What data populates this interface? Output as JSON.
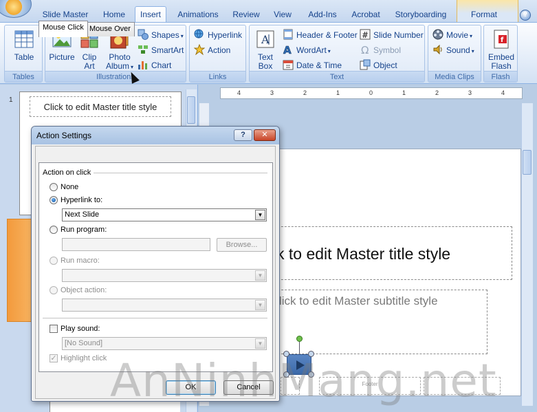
{
  "ribbon_tabs": [
    "Slide Master",
    "Home",
    "Insert",
    "Animations",
    "Review",
    "View",
    "Add-Ins",
    "Acrobat",
    "Storyboarding",
    "Format"
  ],
  "active_tab": "Insert",
  "help_glyph": "?",
  "groups": {
    "tables": {
      "label": "Tables",
      "table": "Table"
    },
    "illustrations": {
      "label": "Illustrations",
      "picture": "Picture",
      "clip_art_1": "Clip",
      "clip_art_2": "Art",
      "photo_album_1": "Photo",
      "photo_album_2": "Album",
      "shapes": "Shapes",
      "smartart": "SmartArt",
      "chart": "Chart"
    },
    "links": {
      "label": "Links",
      "hyperlink": "Hyperlink",
      "action": "Action"
    },
    "text": {
      "label": "Text",
      "text_box_1": "Text",
      "text_box_2": "Box",
      "header_footer": "Header & Footer",
      "wordart": "WordArt",
      "date_time": "Date & Time",
      "slide_number": "Slide Number",
      "symbol": "Symbol",
      "object": "Object"
    },
    "media": {
      "label": "Media Clips",
      "movie": "Movie",
      "sound": "Sound"
    },
    "flash": {
      "label": "Flash",
      "embed_1": "Embed",
      "embed_2": "Flash"
    }
  },
  "thumbnails": {
    "slide_number": "1",
    "thumb_title": "Click to edit Master title style"
  },
  "ruler_ticks": [
    "4",
    "3",
    "2",
    "1",
    "0",
    "1",
    "2",
    "3",
    "4"
  ],
  "slide": {
    "title": "k to edit Master title style",
    "subtitle": "lick to edit Master subtitle style",
    "footer_label": "Footer"
  },
  "watermark": "AnNinhMang.net",
  "dialog": {
    "title": "Action Settings",
    "help": "?",
    "close": "✕",
    "tabs": [
      "Mouse Click",
      "Mouse Over"
    ],
    "section_action": "Action on click",
    "radio_none": "None",
    "radio_hyperlink": "Hyperlink to:",
    "hyperlink_value": "Next Slide",
    "radio_run_program": "Run program:",
    "browse": "Browse...",
    "radio_run_macro": "Run macro:",
    "radio_object_action": "Object action:",
    "play_sound": "Play sound:",
    "sound_value": "[No Sound]",
    "highlight_click": "Highlight click",
    "ok": "OK",
    "cancel": "Cancel"
  }
}
